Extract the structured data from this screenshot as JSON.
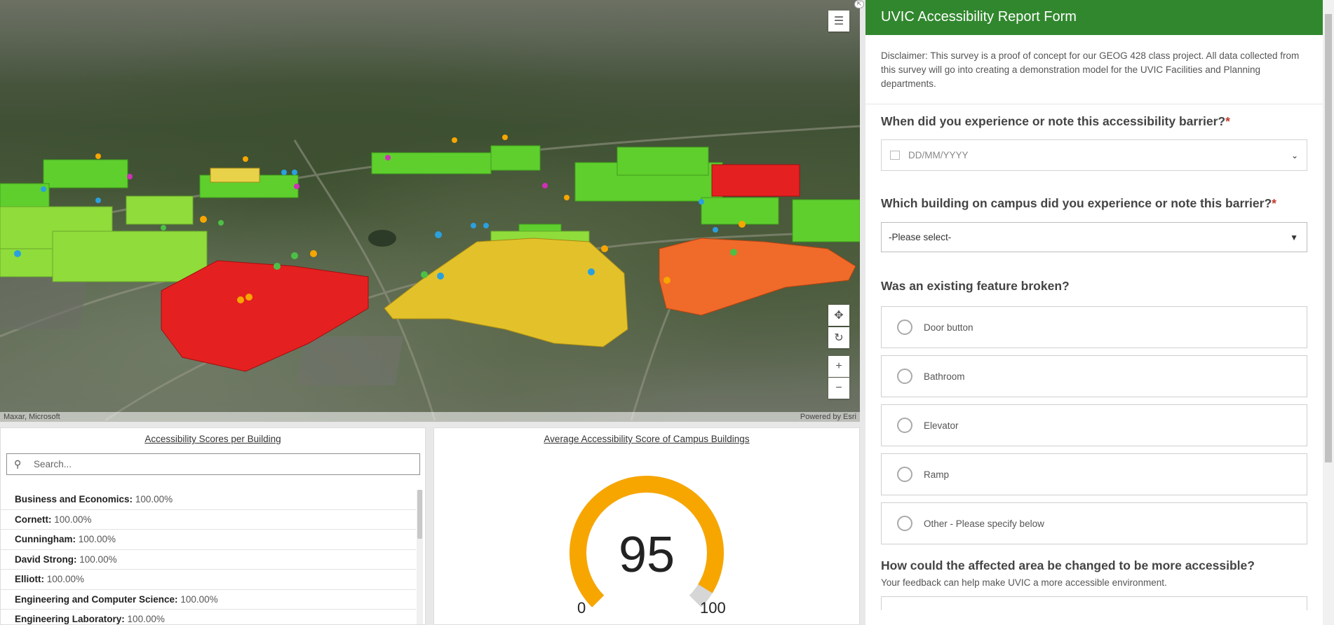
{
  "map": {
    "attribution_left": "Maxar, Microsoft",
    "attribution_right": "Powered by Esri"
  },
  "list_panel": {
    "title": "Accessibility Scores per Building",
    "search_placeholder": "Search...",
    "rows": [
      {
        "name": "Business and Economics:",
        "value": "100.00%"
      },
      {
        "name": "Cornett:",
        "value": "100.00%"
      },
      {
        "name": "Cunningham:",
        "value": "100.00%"
      },
      {
        "name": "David Strong:",
        "value": "100.00%"
      },
      {
        "name": "Elliott:",
        "value": "100.00%"
      },
      {
        "name": "Engineering and Computer Science:",
        "value": "100.00%"
      },
      {
        "name": "Engineering Laboratory:",
        "value": "100.00%"
      }
    ]
  },
  "gauge_panel": {
    "title": "Average Accessibility Score of Campus Buildings",
    "value": "95",
    "min": "0",
    "max": "100",
    "fill_fraction": 0.95,
    "fill_color": "#f7a600",
    "track_color": "#d6d6d6"
  },
  "form": {
    "title": "UVIC Accessibility Report Form",
    "disclaimer": "Disclaimer: This survey is a proof of concept for our GEOG 428 class project. All data collected from this survey will go into creating a demonstration model for the UVIC Facilities and Planning departments.",
    "q1": {
      "label": "When did you experience or note this accessibility barrier?",
      "required_mark": "*",
      "placeholder": "DD/MM/YYYY"
    },
    "q2": {
      "label": "Which building on campus did you experience or note this barrier?",
      "required_mark": "*",
      "selected": "-Please select-"
    },
    "q3": {
      "label": "Was an existing feature broken?",
      "options": [
        "Door button",
        "Bathroom",
        "Elevator",
        "Ramp",
        "Other - Please specify below"
      ]
    },
    "q4": {
      "label": "How could the affected area be changed to be more accessible?",
      "hint": "Your feedback can help make UVIC a more accessible environment."
    },
    "header_color": "#31872e"
  }
}
